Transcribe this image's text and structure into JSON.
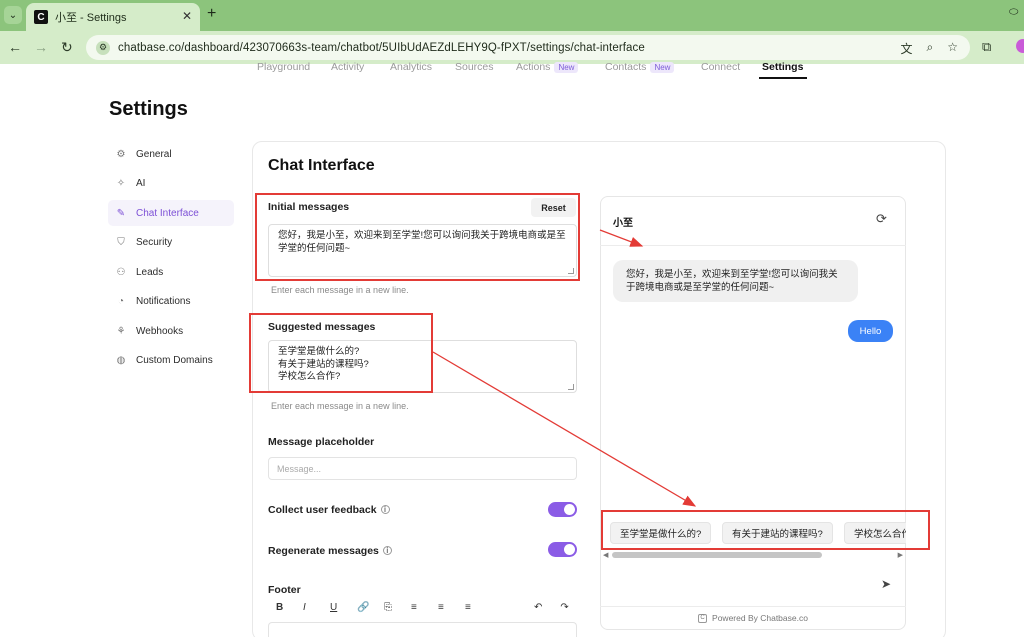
{
  "browser": {
    "tab_title": "小至 - Settings",
    "url": "chatbase.co/dashboard/423070663s-team/chatbot/5UIbUdAEZdLEHY9Q-fPXT/settings/chat-interface",
    "favicon_letter": "C"
  },
  "nav": {
    "items": [
      {
        "label": "Playground",
        "badge": ""
      },
      {
        "label": "Activity",
        "badge": ""
      },
      {
        "label": "Analytics",
        "badge": ""
      },
      {
        "label": "Sources",
        "badge": ""
      },
      {
        "label": "Actions",
        "badge": "New"
      },
      {
        "label": "Contacts",
        "badge": "New"
      },
      {
        "label": "Connect",
        "badge": ""
      },
      {
        "label": "Settings",
        "badge": ""
      }
    ],
    "active": "Settings"
  },
  "page": {
    "title": "Settings"
  },
  "sidebar": {
    "items": [
      {
        "label": "General",
        "icon": "gear-icon"
      },
      {
        "label": "AI",
        "icon": "sparkles-icon"
      },
      {
        "label": "Chat Interface",
        "icon": "brush-icon"
      },
      {
        "label": "Security",
        "icon": "shield-icon"
      },
      {
        "label": "Leads",
        "icon": "users-icon"
      },
      {
        "label": "Notifications",
        "icon": "bell-icon"
      },
      {
        "label": "Webhooks",
        "icon": "webhook-icon"
      },
      {
        "label": "Custom Domains",
        "icon": "globe-icon"
      }
    ],
    "active": "Chat Interface"
  },
  "form": {
    "title": "Chat Interface",
    "initial_messages_label": "Initial messages",
    "reset_label": "Reset",
    "initial_messages_value": "您好，我是小至，欢迎来到至学堂!您可以询问我关于跨境电商或是至学堂的任何问题~",
    "initial_hint": "Enter each message in a new line.",
    "suggested_label": "Suggested messages",
    "suggested_lines": [
      "至学堂是做什么的?",
      "有关于建站的课程吗?",
      "学校怎么合作?"
    ],
    "suggested_hint": "Enter each message in a new line.",
    "placeholder_label": "Message placeholder",
    "placeholder_hint": "Message...",
    "collect_feedback_label": "Collect user feedback",
    "collect_feedback_on": true,
    "regenerate_label": "Regenerate messages",
    "regenerate_on": true,
    "footer_label": "Footer",
    "toolbar": [
      "B",
      "I",
      "U",
      "🔗",
      "⎘",
      "≡",
      "≡",
      "≡"
    ]
  },
  "preview": {
    "bot_name": "小至",
    "bot_message": "您好，我是小至，欢迎来到至学堂!您可以询问我关于跨境电商或是至学堂的任何问题~",
    "user_message": "Hello",
    "suggestions": [
      "至学堂是做什么的?",
      "有关于建站的课程吗?",
      "学校怎么合作"
    ],
    "powered_by": "Powered By Chatbase.co"
  },
  "colors": {
    "accent": "#8b5ce6",
    "annotation": "#e33b36",
    "user_bubble": "#3b82f6",
    "chrome": "#8cc47c"
  }
}
